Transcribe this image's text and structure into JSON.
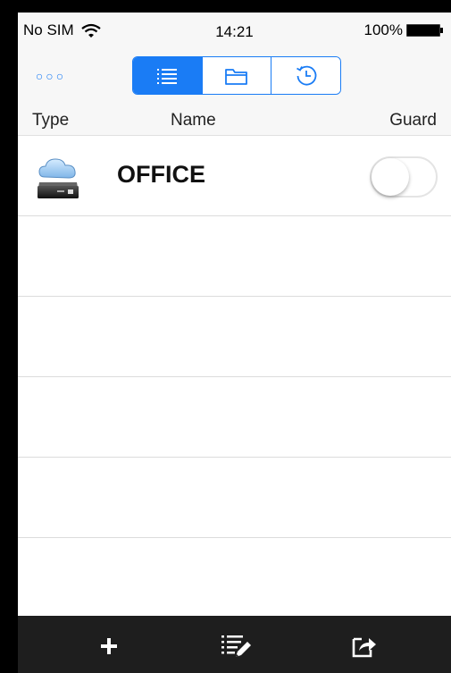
{
  "status_bar": {
    "carrier": "No SIM",
    "time": "14:21",
    "battery": "100%"
  },
  "nav": {
    "more_label": "○○○",
    "segments": [
      {
        "icon": "list-icon",
        "active": true
      },
      {
        "icon": "folder-icon",
        "active": false
      },
      {
        "icon": "history-clock-icon",
        "active": false
      }
    ]
  },
  "table": {
    "columns": [
      "Type",
      "Name",
      "Guard"
    ],
    "rows": [
      {
        "icon": "cloud-server-icon",
        "name": "OFFICE",
        "guard": false
      }
    ],
    "empty_rows": 5
  },
  "tab_bar": {
    "items": [
      {
        "icon": "plus-icon"
      },
      {
        "icon": "edit-list-icon"
      },
      {
        "icon": "share-icon"
      }
    ]
  },
  "colors": {
    "accent": "#1a7cf5",
    "tab_bar": "#1e1e1e",
    "background": "#ffffff"
  }
}
